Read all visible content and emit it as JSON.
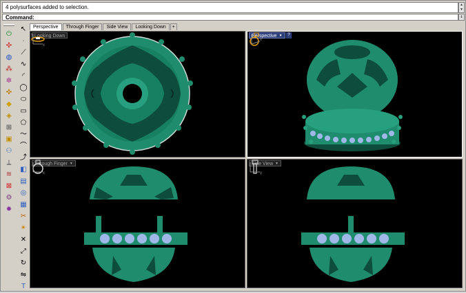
{
  "command": {
    "history": "4 polysurfaces added to selection.",
    "prompt": "Command:"
  },
  "tabs": [
    {
      "label": "Perspective",
      "active": true
    },
    {
      "label": "Through Finger",
      "active": false
    },
    {
      "label": "Side View",
      "active": false
    },
    {
      "label": "Looking Down",
      "active": false
    }
  ],
  "tab_add": "+",
  "viewports": {
    "looking_down": {
      "title": "Looking Down"
    },
    "perspective": {
      "title": "Perspective",
      "help": "?"
    },
    "through_finger": {
      "title": "Through Finger"
    },
    "side_view": {
      "title": "Side View"
    }
  },
  "axis_labels": {
    "x": "x",
    "y": "y"
  },
  "colors": {
    "model_green": "#1f8c6e",
    "model_dark": "#0e4d3c",
    "gem_blue": "#9fb8e8",
    "viewport_bg": "#000000",
    "active_title": "#2c3e78"
  }
}
